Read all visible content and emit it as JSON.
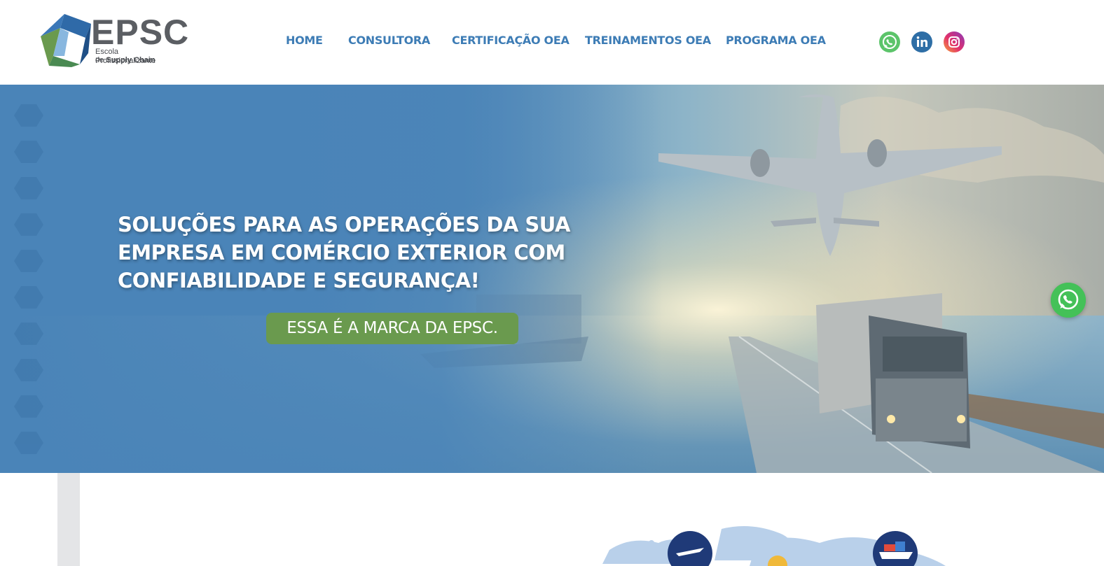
{
  "brand": {
    "title": "EPSC",
    "subtitle_line1": "Escola Profissionalizante",
    "subtitle_prefix": "de ",
    "subtitle_bold": "Supply Chain"
  },
  "nav": {
    "items": [
      {
        "label": "HOME"
      },
      {
        "label": "CONSULTORA"
      },
      {
        "label": "CERTIFICAÇÃO OEA"
      },
      {
        "label": "TREINAMENTOS OEA"
      },
      {
        "label": "PROGRAMA OEA"
      }
    ]
  },
  "social": {
    "icons": [
      "whatsapp-icon",
      "linkedin-icon",
      "instagram-icon"
    ]
  },
  "hero": {
    "title_lines": [
      "SOLUÇÕES PARA AS OPERAÇÕES DA SUA",
      "EMPRESA EM COMÉRCIO EXTERIOR COM",
      "CONFIABILIDADE E SEGURANÇA!"
    ],
    "cta_label": "ESSA É A MARCA DA EPSC."
  },
  "colors": {
    "nav_text": "#3d7cb5",
    "hero_blue": "#4a84b8",
    "cta_green": "#6a9a4e",
    "whatsapp_green": "#44c158",
    "linkedin_blue": "#2e6ea6",
    "logo_gray": "#5b5e63"
  }
}
